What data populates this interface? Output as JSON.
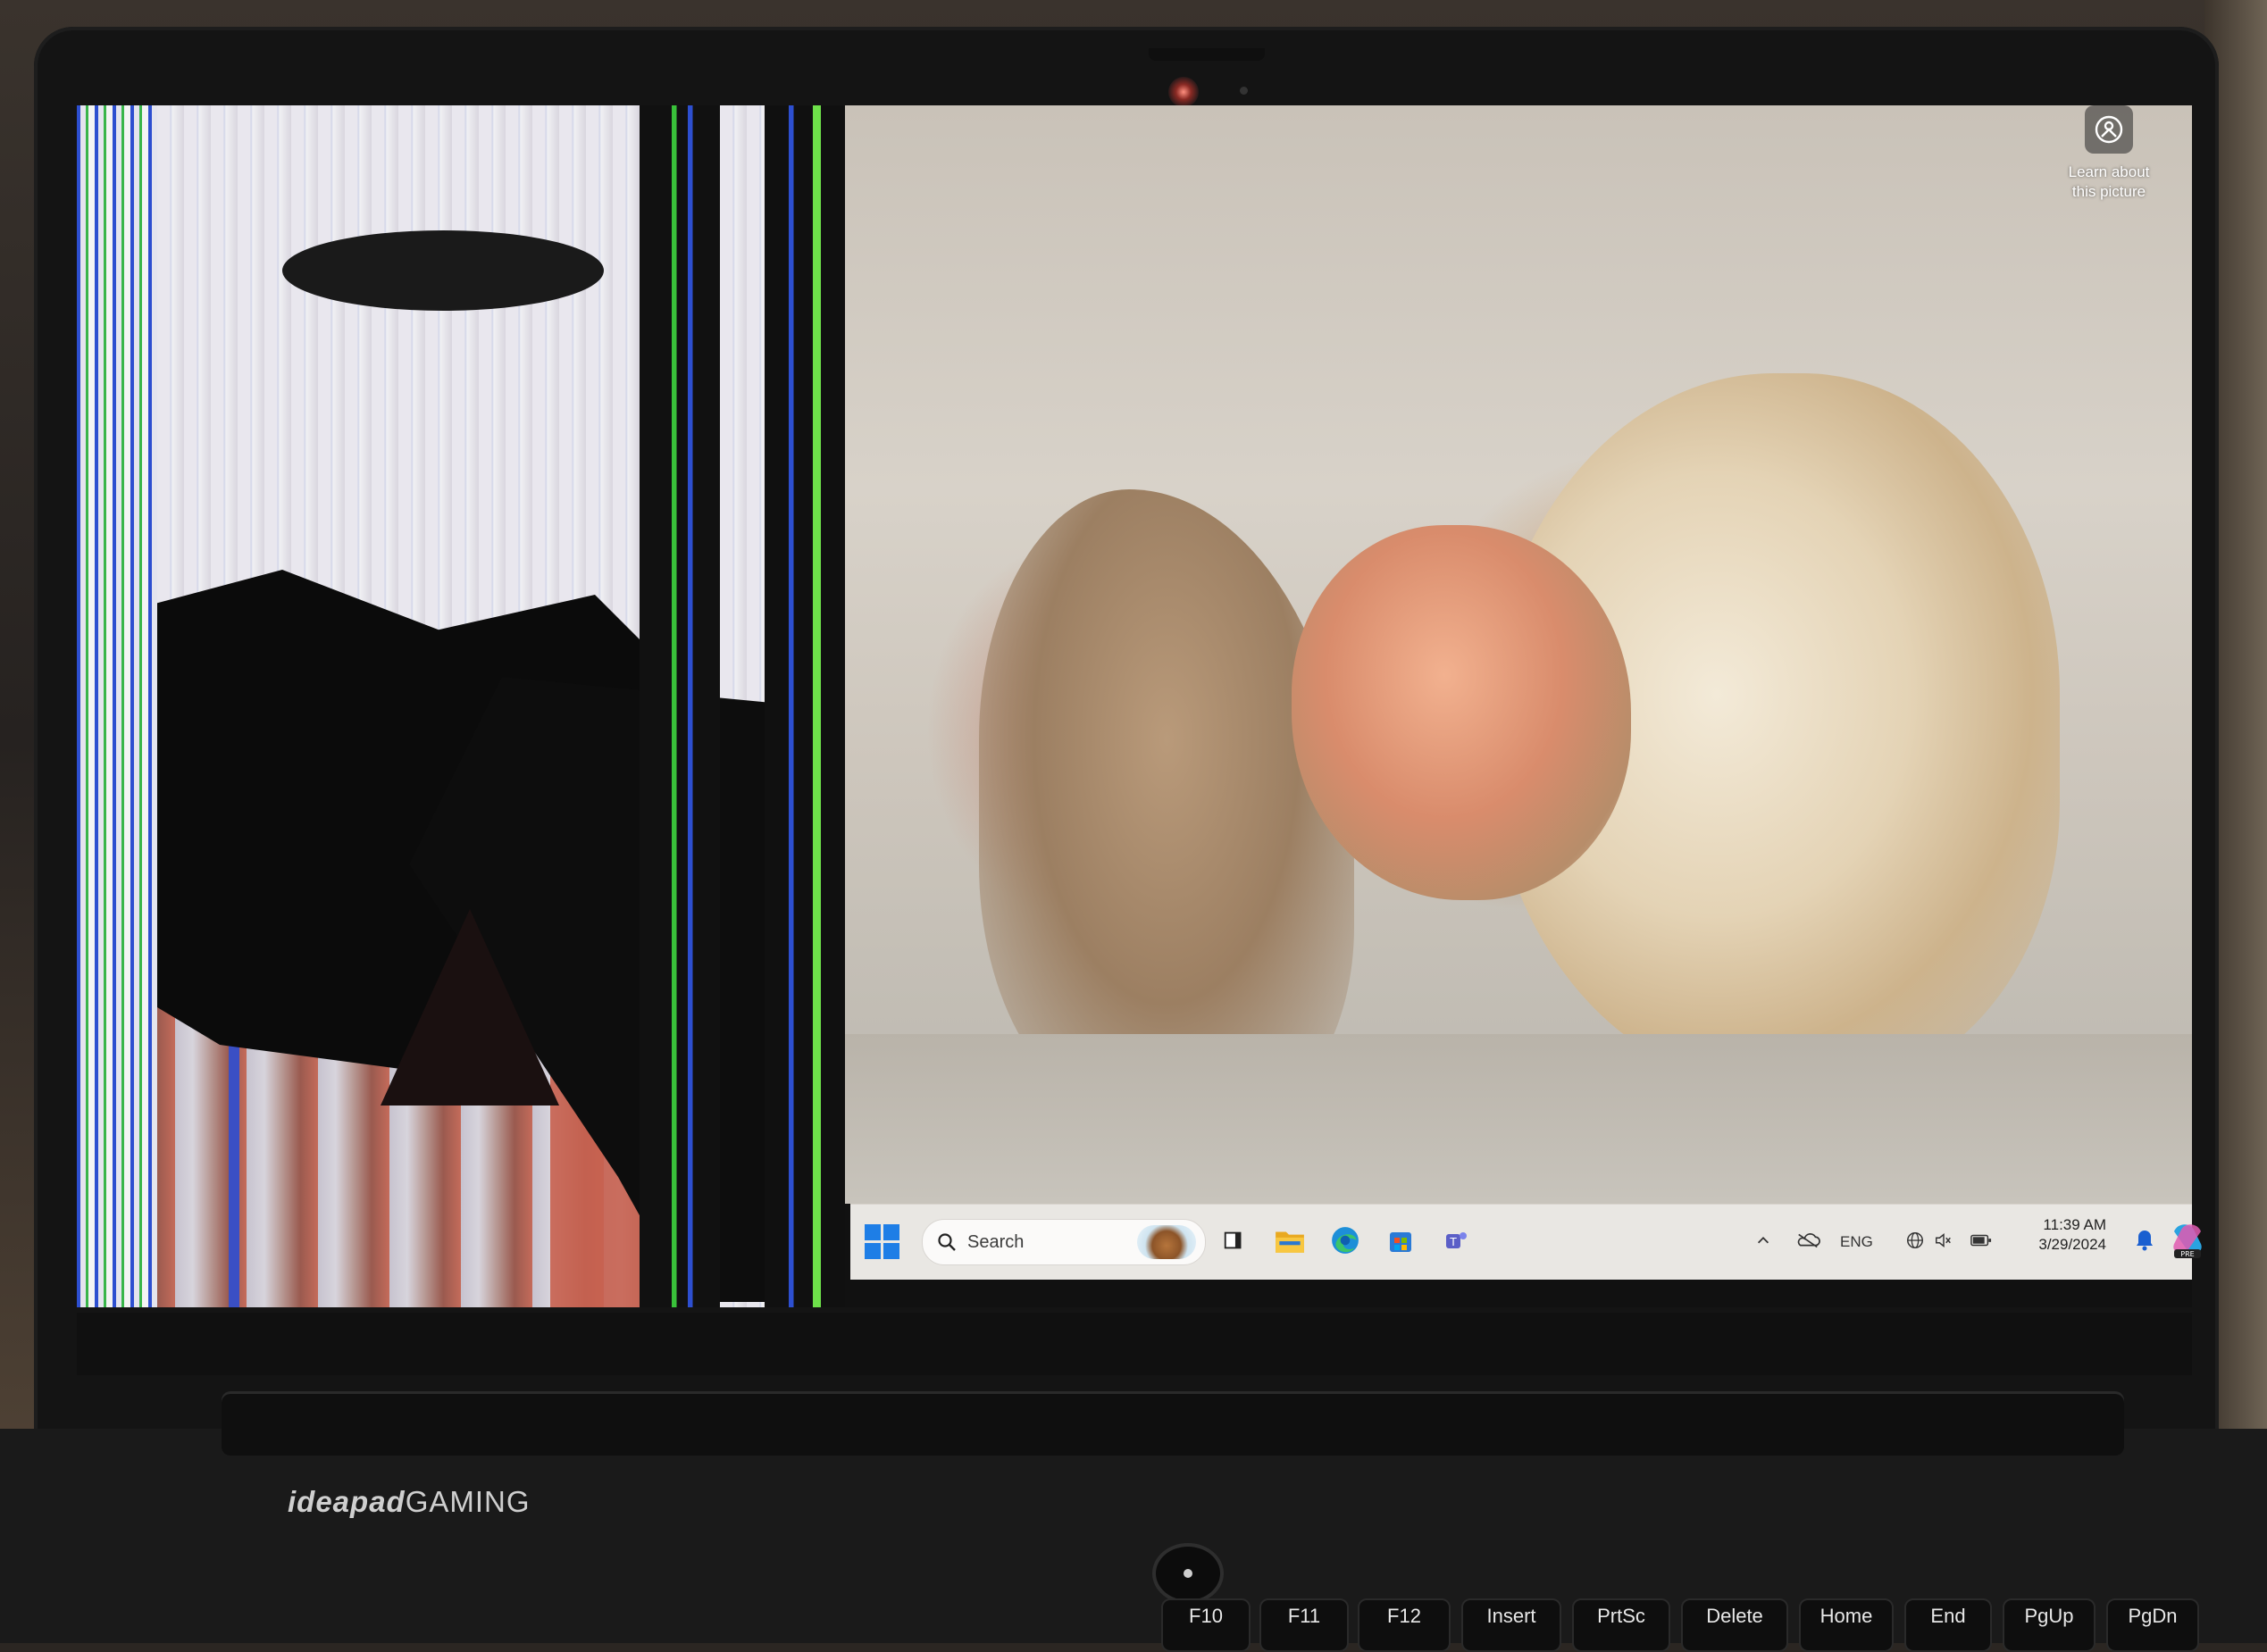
{
  "desktop": {
    "learn_about_line1": "Learn about",
    "learn_about_line2": "this picture"
  },
  "taskbar": {
    "search_placeholder": "Search",
    "language": "ENG",
    "time": "11:39 AM",
    "date": "3/29/2024",
    "copilot_badge": "PRE",
    "pinned_apps": [
      "task-view-icon",
      "file-explorer-icon",
      "edge-icon",
      "microsoft-store-icon",
      "teams-icon"
    ],
    "tray_icons": [
      "chevron-up-icon",
      "onedrive-icon",
      "network-icon",
      "volume-muted-icon",
      "battery-icon"
    ]
  },
  "laptop": {
    "brand_ideapad": "ideapad",
    "brand_gaming": "GAMING"
  },
  "keyboard": {
    "keys": [
      "F10",
      "F11",
      "F12",
      "Insert",
      "PrtSc",
      "Delete",
      "Home",
      "End",
      "PgUp",
      "PgDn"
    ]
  },
  "colors": {
    "start_blue": "#1e7ee6",
    "taskbar_bg": "#f3f0ec",
    "bezel": "#141414"
  }
}
